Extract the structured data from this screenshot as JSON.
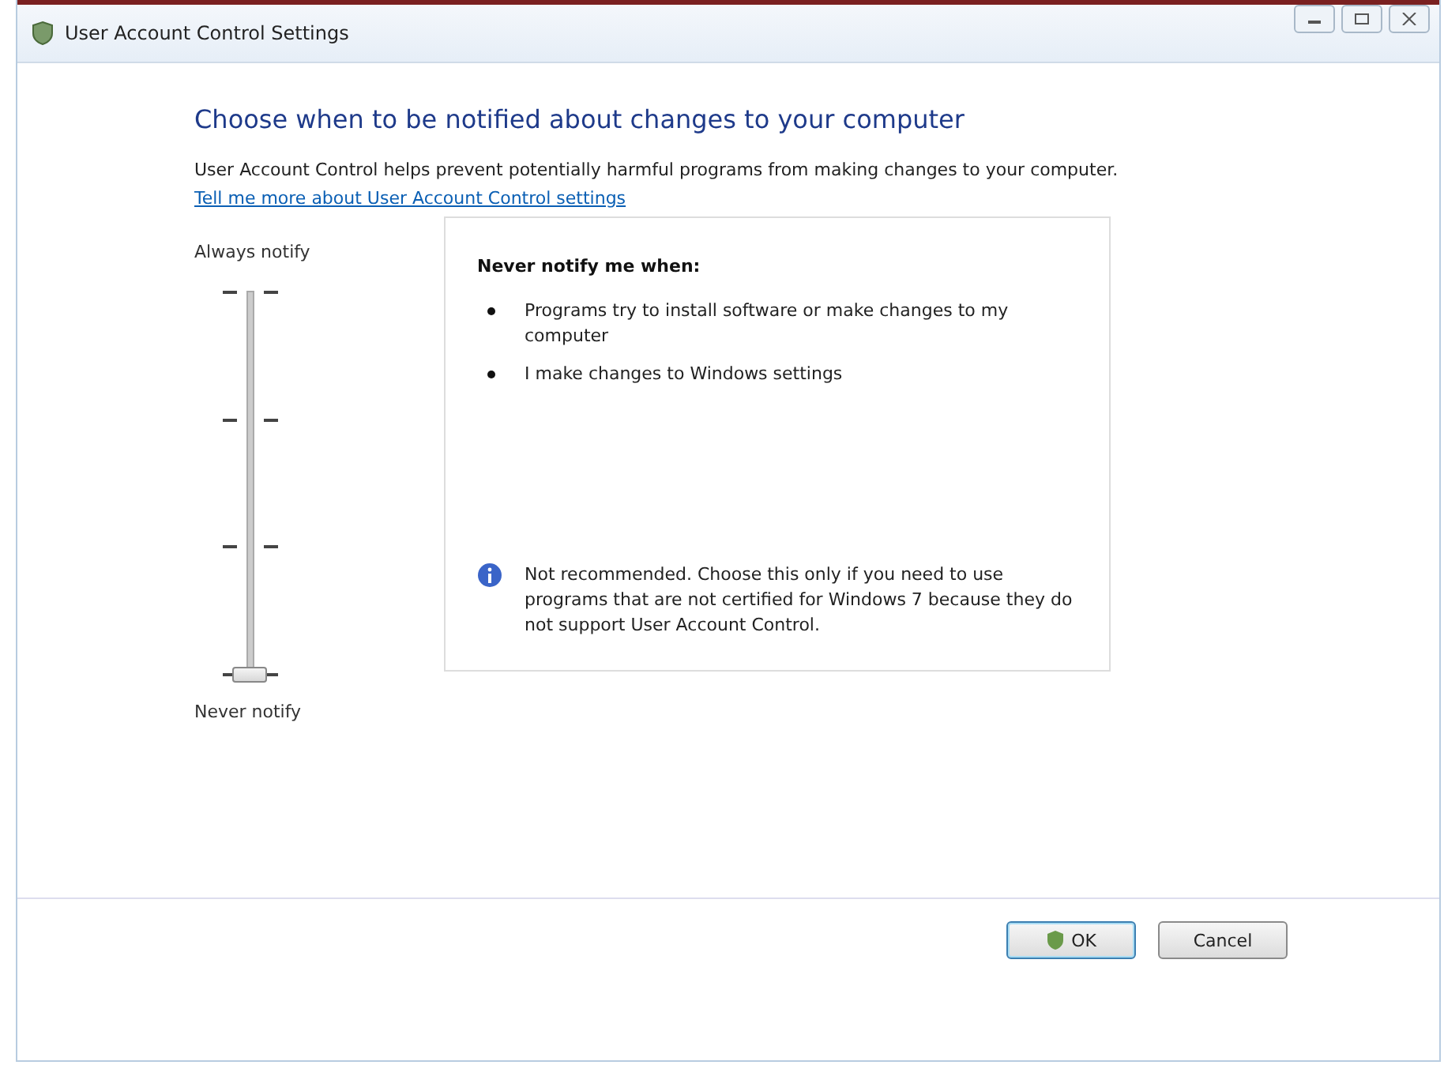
{
  "window": {
    "title": "User Account Control Settings"
  },
  "heading": "Choose when to be notified about changes to your computer",
  "description": "User Account Control helps prevent potentially harmful programs from making changes to your computer.",
  "link": "Tell me more about User Account Control settings",
  "slider": {
    "top_label": "Always notify",
    "bottom_label": "Never notify",
    "level": 0
  },
  "details": {
    "title": "Never notify me when:",
    "bullets": [
      "Programs try to install software or make changes to my computer",
      "I make changes to Windows settings"
    ],
    "note": "Not recommended. Choose this only if you need to use programs that are not certified for Windows 7 because they do not support User Account Control."
  },
  "buttons": [
    {
      "label": "OK",
      "kind": "shield"
    },
    {
      "label": "Cancel",
      "kind": "plain"
    }
  ]
}
